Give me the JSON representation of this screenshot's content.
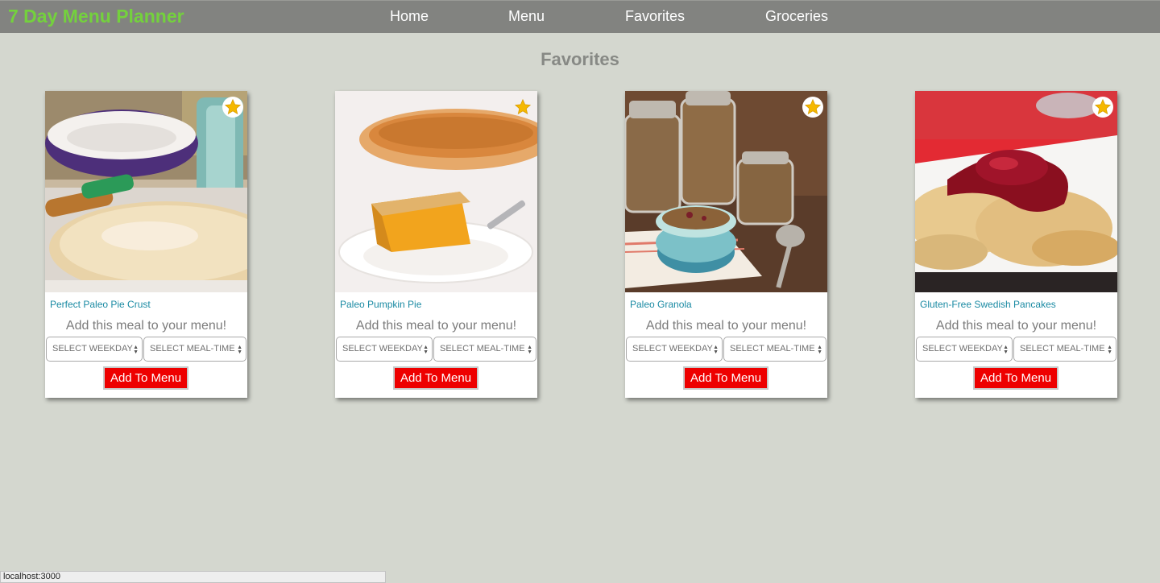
{
  "app": {
    "brand": "7 Day Menu Planner"
  },
  "nav": {
    "items": [
      {
        "label": "Home"
      },
      {
        "label": "Menu"
      },
      {
        "label": "Favorites"
      },
      {
        "label": "Groceries"
      }
    ]
  },
  "page": {
    "title": "Favorites"
  },
  "cards": [
    {
      "title": "Perfect Paleo Pie Crust",
      "prompt": "Add this meal to your menu!",
      "weekday_select": "SELECT WEEKDAY",
      "mealtime_select": "SELECT MEAL-TIME",
      "button": "Add To Menu",
      "favorite_icon": "star-icon"
    },
    {
      "title": "Paleo Pumpkin Pie",
      "prompt": "Add this meal to your menu!",
      "weekday_select": "SELECT WEEKDAY",
      "mealtime_select": "SELECT MEAL-TIME",
      "button": "Add To Menu",
      "favorite_icon": "star-icon"
    },
    {
      "title": "Paleo Granola",
      "prompt": "Add this meal to your menu!",
      "weekday_select": "SELECT WEEKDAY",
      "mealtime_select": "SELECT MEAL-TIME",
      "button": "Add To Menu",
      "favorite_icon": "star-icon"
    },
    {
      "title": "Gluten-Free Swedish Pancakes",
      "prompt": "Add this meal to your menu!",
      "weekday_select": "SELECT WEEKDAY",
      "mealtime_select": "SELECT MEAL-TIME",
      "button": "Add To Menu",
      "favorite_icon": "star-icon"
    }
  ],
  "status_bar": {
    "url": "localhost:3000"
  },
  "colors": {
    "brand": "#74d13d",
    "navbar": "#828380",
    "background": "#d4d7cf",
    "button": "#ee0000",
    "link": "#1a8aa3",
    "star": "#f5b800"
  }
}
